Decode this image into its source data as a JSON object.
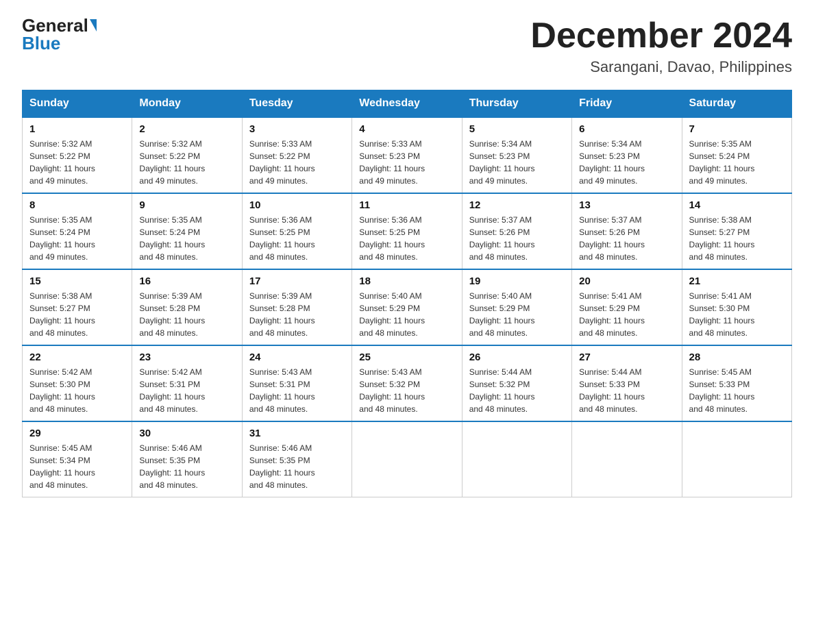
{
  "header": {
    "logo_general": "General",
    "logo_blue": "Blue",
    "month_year": "December 2024",
    "location": "Sarangani, Davao, Philippines"
  },
  "days_of_week": [
    "Sunday",
    "Monday",
    "Tuesday",
    "Wednesday",
    "Thursday",
    "Friday",
    "Saturday"
  ],
  "weeks": [
    [
      {
        "day": "1",
        "sunrise": "5:32 AM",
        "sunset": "5:22 PM",
        "daylight": "11 hours and 49 minutes."
      },
      {
        "day": "2",
        "sunrise": "5:32 AM",
        "sunset": "5:22 PM",
        "daylight": "11 hours and 49 minutes."
      },
      {
        "day": "3",
        "sunrise": "5:33 AM",
        "sunset": "5:22 PM",
        "daylight": "11 hours and 49 minutes."
      },
      {
        "day": "4",
        "sunrise": "5:33 AM",
        "sunset": "5:23 PM",
        "daylight": "11 hours and 49 minutes."
      },
      {
        "day": "5",
        "sunrise": "5:34 AM",
        "sunset": "5:23 PM",
        "daylight": "11 hours and 49 minutes."
      },
      {
        "day": "6",
        "sunrise": "5:34 AM",
        "sunset": "5:23 PM",
        "daylight": "11 hours and 49 minutes."
      },
      {
        "day": "7",
        "sunrise": "5:35 AM",
        "sunset": "5:24 PM",
        "daylight": "11 hours and 49 minutes."
      }
    ],
    [
      {
        "day": "8",
        "sunrise": "5:35 AM",
        "sunset": "5:24 PM",
        "daylight": "11 hours and 49 minutes."
      },
      {
        "day": "9",
        "sunrise": "5:35 AM",
        "sunset": "5:24 PM",
        "daylight": "11 hours and 48 minutes."
      },
      {
        "day": "10",
        "sunrise": "5:36 AM",
        "sunset": "5:25 PM",
        "daylight": "11 hours and 48 minutes."
      },
      {
        "day": "11",
        "sunrise": "5:36 AM",
        "sunset": "5:25 PM",
        "daylight": "11 hours and 48 minutes."
      },
      {
        "day": "12",
        "sunrise": "5:37 AM",
        "sunset": "5:26 PM",
        "daylight": "11 hours and 48 minutes."
      },
      {
        "day": "13",
        "sunrise": "5:37 AM",
        "sunset": "5:26 PM",
        "daylight": "11 hours and 48 minutes."
      },
      {
        "day": "14",
        "sunrise": "5:38 AM",
        "sunset": "5:27 PM",
        "daylight": "11 hours and 48 minutes."
      }
    ],
    [
      {
        "day": "15",
        "sunrise": "5:38 AM",
        "sunset": "5:27 PM",
        "daylight": "11 hours and 48 minutes."
      },
      {
        "day": "16",
        "sunrise": "5:39 AM",
        "sunset": "5:28 PM",
        "daylight": "11 hours and 48 minutes."
      },
      {
        "day": "17",
        "sunrise": "5:39 AM",
        "sunset": "5:28 PM",
        "daylight": "11 hours and 48 minutes."
      },
      {
        "day": "18",
        "sunrise": "5:40 AM",
        "sunset": "5:29 PM",
        "daylight": "11 hours and 48 minutes."
      },
      {
        "day": "19",
        "sunrise": "5:40 AM",
        "sunset": "5:29 PM",
        "daylight": "11 hours and 48 minutes."
      },
      {
        "day": "20",
        "sunrise": "5:41 AM",
        "sunset": "5:29 PM",
        "daylight": "11 hours and 48 minutes."
      },
      {
        "day": "21",
        "sunrise": "5:41 AM",
        "sunset": "5:30 PM",
        "daylight": "11 hours and 48 minutes."
      }
    ],
    [
      {
        "day": "22",
        "sunrise": "5:42 AM",
        "sunset": "5:30 PM",
        "daylight": "11 hours and 48 minutes."
      },
      {
        "day": "23",
        "sunrise": "5:42 AM",
        "sunset": "5:31 PM",
        "daylight": "11 hours and 48 minutes."
      },
      {
        "day": "24",
        "sunrise": "5:43 AM",
        "sunset": "5:31 PM",
        "daylight": "11 hours and 48 minutes."
      },
      {
        "day": "25",
        "sunrise": "5:43 AM",
        "sunset": "5:32 PM",
        "daylight": "11 hours and 48 minutes."
      },
      {
        "day": "26",
        "sunrise": "5:44 AM",
        "sunset": "5:32 PM",
        "daylight": "11 hours and 48 minutes."
      },
      {
        "day": "27",
        "sunrise": "5:44 AM",
        "sunset": "5:33 PM",
        "daylight": "11 hours and 48 minutes."
      },
      {
        "day": "28",
        "sunrise": "5:45 AM",
        "sunset": "5:33 PM",
        "daylight": "11 hours and 48 minutes."
      }
    ],
    [
      {
        "day": "29",
        "sunrise": "5:45 AM",
        "sunset": "5:34 PM",
        "daylight": "11 hours and 48 minutes."
      },
      {
        "day": "30",
        "sunrise": "5:46 AM",
        "sunset": "5:35 PM",
        "daylight": "11 hours and 48 minutes."
      },
      {
        "day": "31",
        "sunrise": "5:46 AM",
        "sunset": "5:35 PM",
        "daylight": "11 hours and 48 minutes."
      },
      null,
      null,
      null,
      null
    ]
  ],
  "labels": {
    "sunrise": "Sunrise:",
    "sunset": "Sunset:",
    "daylight": "Daylight:"
  }
}
